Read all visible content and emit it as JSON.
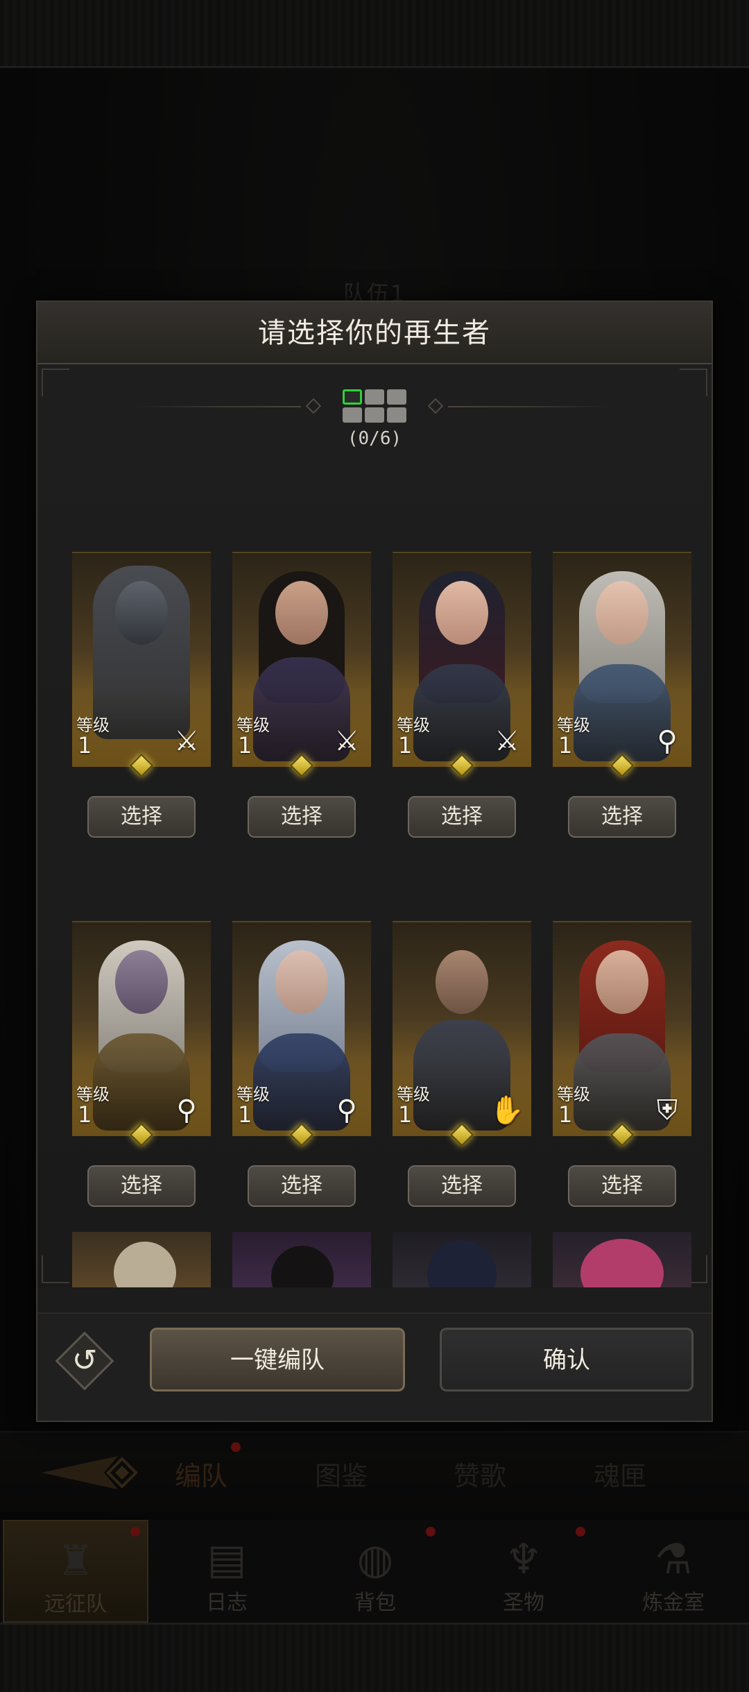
{
  "background": {
    "team_title": "队伍1",
    "tabs": [
      "编队",
      "图鉴",
      "赞歌",
      "魂匣"
    ],
    "nav": [
      "远征队",
      "日志",
      "背包",
      "圣物",
      "炼金室"
    ]
  },
  "dialog": {
    "title": "请选择你的再生者",
    "selected_count": "(0/6)",
    "level_label": "等级",
    "select_label": "选择",
    "heroes": [
      {
        "level": "1",
        "class_icon": "sword-icon"
      },
      {
        "level": "1",
        "class_icon": "sword-icon"
      },
      {
        "level": "1",
        "class_icon": "sword-icon"
      },
      {
        "level": "1",
        "class_icon": "staff-icon"
      },
      {
        "level": "1",
        "class_icon": "staff-icon"
      },
      {
        "level": "1",
        "class_icon": "staff-icon"
      },
      {
        "level": "1",
        "class_icon": "palm-icon"
      },
      {
        "level": "1",
        "class_icon": "shield-icon"
      }
    ],
    "auto_team_label": "一键编队",
    "confirm_label": "确认"
  },
  "colors": {
    "slot_selected": "#2ed13a",
    "gem": "#e8cf3f",
    "card_gold": "#a47a26"
  }
}
